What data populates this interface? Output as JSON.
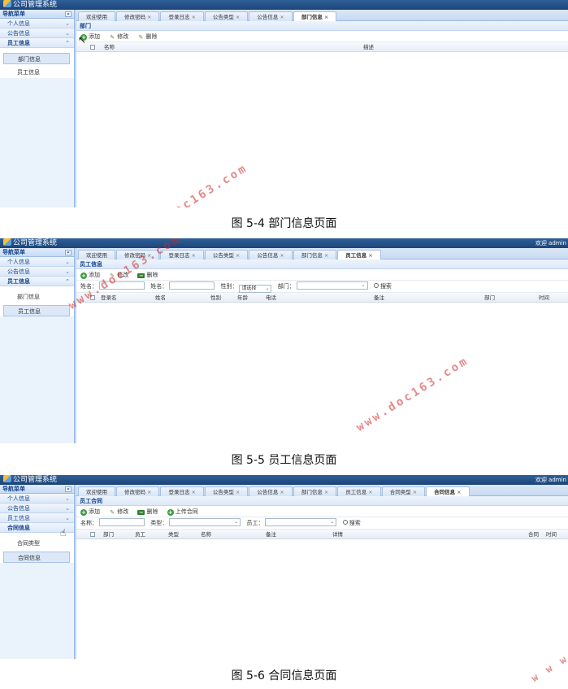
{
  "app_title": "公司管理系统",
  "welcome": "欢迎 admin",
  "sidebar": {
    "header": "导航菜单",
    "collapse_glyph": "«",
    "sections": [
      "个人信息",
      "公告信息",
      "员工信息"
    ],
    "section4": "合同信息",
    "employee_items": [
      "部门信息",
      "员工信息"
    ],
    "contract_items": [
      "合同类型",
      "合同信息"
    ]
  },
  "tabs": {
    "welcome": "欢迎使用",
    "pwd": "修改密码",
    "log": "登录日志",
    "notice_type": "公告类型",
    "notice": "公告信息",
    "dept": "部门信息",
    "emp": "员工信息",
    "contract_type": "合同类型",
    "contract": "合同信息",
    "close": "×"
  },
  "screen1": {
    "panel_title": "部门",
    "toolbar": {
      "add": "添加",
      "edit": "修改",
      "delete": "删除"
    },
    "columns": [
      "名称",
      "描述"
    ]
  },
  "screen2": {
    "panel_title": "员工信息",
    "toolbar": {
      "add": "添加",
      "edit": "修改",
      "delete": "删除"
    },
    "filters": {
      "name": "姓名：",
      "real_name": "姓名：",
      "gender": "性别：",
      "gender_value": "请选择",
      "dept": "部门：",
      "search": "搜索"
    },
    "columns": [
      "登录名",
      "姓名",
      "性别",
      "年龄",
      "电话",
      "备注",
      "部门",
      "时间"
    ]
  },
  "screen3": {
    "panel_title": "员工合同",
    "toolbar": {
      "add": "添加",
      "edit": "修改",
      "delete": "删除",
      "upload": "上传合同"
    },
    "filters": {
      "name": "名称：",
      "type": "类型：",
      "emp": "员工：",
      "search": "搜索"
    },
    "columns": [
      "部门",
      "员工",
      "类型",
      "名称",
      "备注",
      "详情",
      "合同",
      "时间"
    ]
  },
  "captions": {
    "c1": "图 5-4 部门信息页面",
    "c2": "图 5-5 员工信息页面",
    "c3": "图 5-6 合同信息页面"
  },
  "watermark": "www.doc163.com",
  "watermark_short": "w w w",
  "icons": {
    "add": "plus-circle-icon",
    "edit": "pencil-icon",
    "delete": "minus-icon",
    "search": "search-icon",
    "cursor": "hand-cursor-icon"
  },
  "colors": {
    "titlebar": "#1d4578",
    "accent": "#15428b",
    "watermark": "#d22828"
  }
}
